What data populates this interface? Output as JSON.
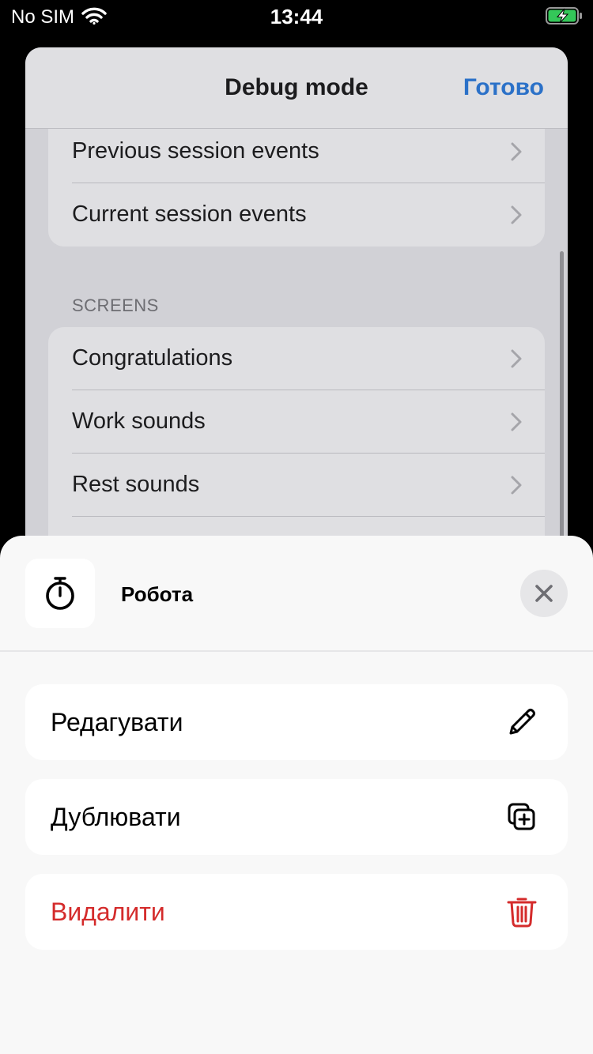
{
  "status_bar": {
    "carrier": "No SIM",
    "time": "13:44"
  },
  "debug_screen": {
    "title": "Debug mode",
    "done_label": "Готово",
    "top_items": [
      {
        "label": "Previous session events"
      },
      {
        "label": "Current session events"
      }
    ],
    "screens_header": "SCREENS",
    "screen_items": [
      {
        "label": "Congratulations"
      },
      {
        "label": "Work sounds"
      },
      {
        "label": "Rest sounds"
      }
    ]
  },
  "sheet": {
    "title": "Робота",
    "icon": "stopwatch-icon",
    "actions": [
      {
        "label": "Редагувати",
        "icon": "pencil-icon"
      },
      {
        "label": "Дублювати",
        "icon": "duplicate-icon"
      },
      {
        "label": "Видалити",
        "icon": "trash-icon",
        "color": "#d42b2b"
      }
    ]
  },
  "colors": {
    "accent": "#2b71c8",
    "destructive": "#d42b2b",
    "battery_charging": "#34c759"
  }
}
